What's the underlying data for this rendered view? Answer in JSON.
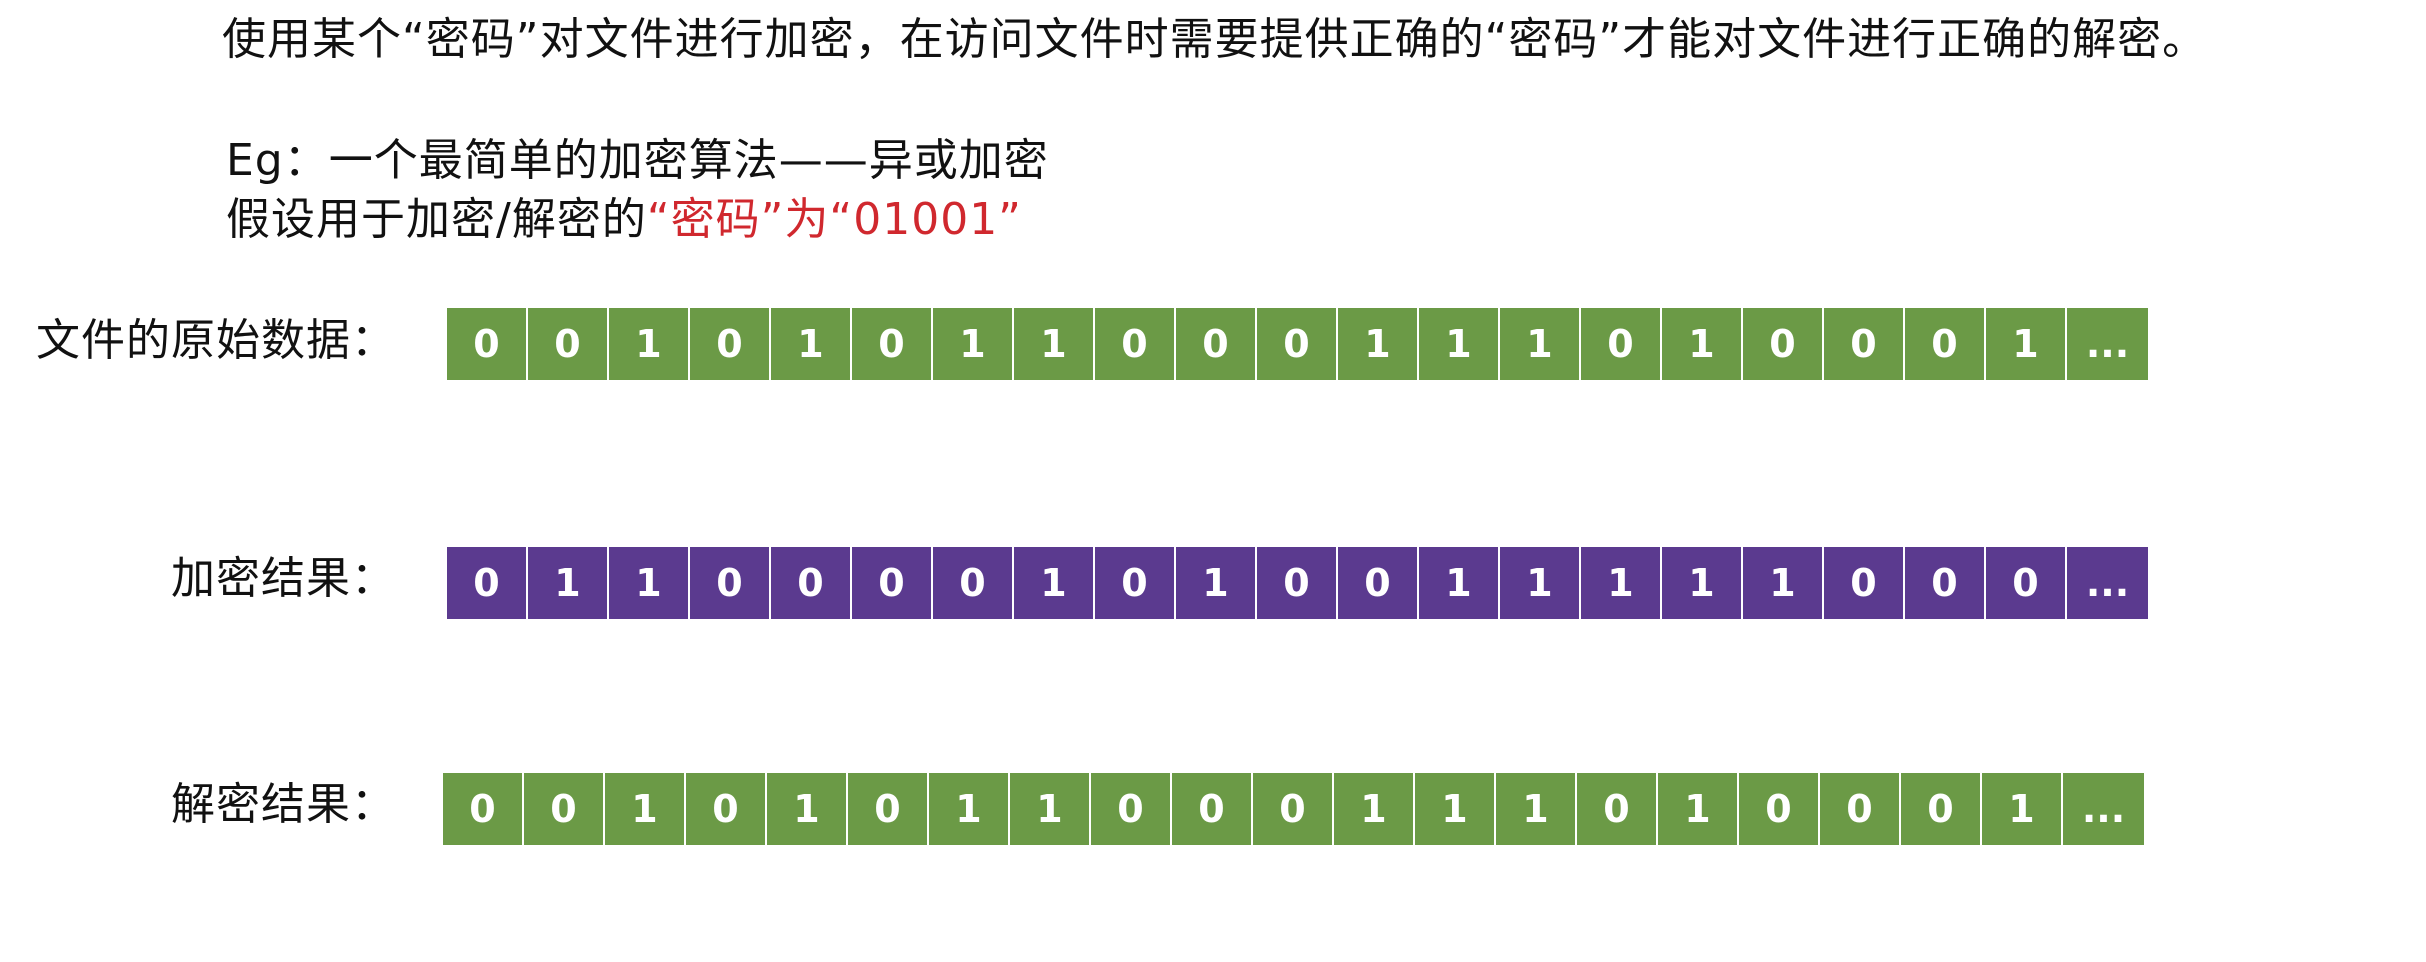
{
  "intro": "使用某个“密码”对文件进行加密，在访问文件时需要提供正确的“密码”才能对文件进行正确的解密。",
  "example": {
    "line1": "Eg：一个最简单的加密算法——异或加密",
    "line2_prefix": "假设用于加密/解密的",
    "line2_key": "“密码”为“01001”"
  },
  "colors": {
    "original": "#6b9a46",
    "encrypted": "#5b3a8f",
    "decrypted": "#6b9a46",
    "key_text": "#d0282e"
  },
  "rows": {
    "original": {
      "label": "文件的原始数据：",
      "bits": [
        "0",
        "0",
        "1",
        "0",
        "1",
        "0",
        "1",
        "1",
        "0",
        "0",
        "0",
        "1",
        "1",
        "1",
        "0",
        "1",
        "0",
        "0",
        "0",
        "1",
        "..."
      ]
    },
    "encrypted": {
      "label": "加密结果：",
      "bits": [
        "0",
        "1",
        "1",
        "0",
        "0",
        "0",
        "0",
        "1",
        "0",
        "1",
        "0",
        "0",
        "1",
        "1",
        "1",
        "1",
        "1",
        "0",
        "0",
        "0",
        "..."
      ]
    },
    "decrypted": {
      "label": "解密结果：",
      "bits": [
        "0",
        "0",
        "1",
        "0",
        "1",
        "0",
        "1",
        "1",
        "0",
        "0",
        "0",
        "1",
        "1",
        "1",
        "0",
        "1",
        "0",
        "0",
        "0",
        "1",
        "..."
      ]
    }
  }
}
